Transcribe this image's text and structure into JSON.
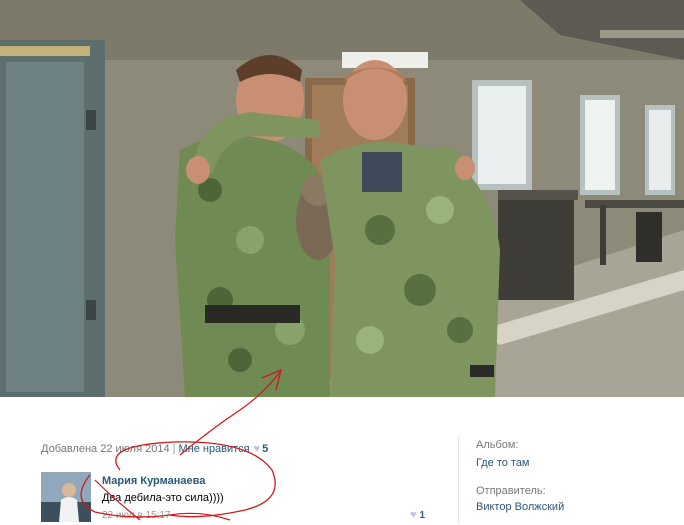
{
  "photo": {
    "alt_subject": "two men in camouflage with a cat"
  },
  "meta": {
    "added_label": "Добавлена 22 июля 2014",
    "separator": "|",
    "like_label": "Мне нравится",
    "like_count": "5"
  },
  "comment": {
    "author": "Мария Курманаева",
    "text": "Два дебила-это сила))))",
    "date": "22 июл в 15:17",
    "like_count": "1"
  },
  "sidebar": {
    "album_label": "Альбом:",
    "album_value": "Где то там",
    "sender_label": "Отправитель:",
    "sender_value": "Виктор Волжский"
  },
  "colors": {
    "link": "#2b587a",
    "muted": "#777777",
    "annotation": "#d0191b"
  },
  "icons": {
    "like": "heart-icon"
  }
}
